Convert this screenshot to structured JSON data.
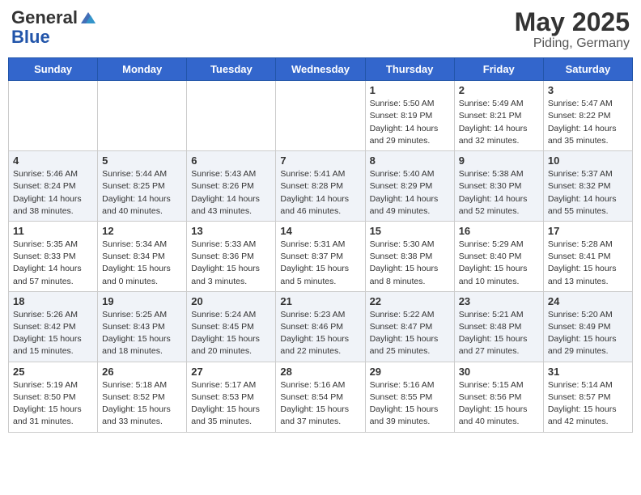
{
  "header": {
    "logo_general": "General",
    "logo_blue": "Blue",
    "month": "May 2025",
    "location": "Piding, Germany"
  },
  "weekdays": [
    "Sunday",
    "Monday",
    "Tuesday",
    "Wednesday",
    "Thursday",
    "Friday",
    "Saturday"
  ],
  "weeks": [
    [
      {
        "day": "",
        "info": ""
      },
      {
        "day": "",
        "info": ""
      },
      {
        "day": "",
        "info": ""
      },
      {
        "day": "",
        "info": ""
      },
      {
        "day": "1",
        "info": "Sunrise: 5:50 AM\nSunset: 8:19 PM\nDaylight: 14 hours\nand 29 minutes."
      },
      {
        "day": "2",
        "info": "Sunrise: 5:49 AM\nSunset: 8:21 PM\nDaylight: 14 hours\nand 32 minutes."
      },
      {
        "day": "3",
        "info": "Sunrise: 5:47 AM\nSunset: 8:22 PM\nDaylight: 14 hours\nand 35 minutes."
      }
    ],
    [
      {
        "day": "4",
        "info": "Sunrise: 5:46 AM\nSunset: 8:24 PM\nDaylight: 14 hours\nand 38 minutes."
      },
      {
        "day": "5",
        "info": "Sunrise: 5:44 AM\nSunset: 8:25 PM\nDaylight: 14 hours\nand 40 minutes."
      },
      {
        "day": "6",
        "info": "Sunrise: 5:43 AM\nSunset: 8:26 PM\nDaylight: 14 hours\nand 43 minutes."
      },
      {
        "day": "7",
        "info": "Sunrise: 5:41 AM\nSunset: 8:28 PM\nDaylight: 14 hours\nand 46 minutes."
      },
      {
        "day": "8",
        "info": "Sunrise: 5:40 AM\nSunset: 8:29 PM\nDaylight: 14 hours\nand 49 minutes."
      },
      {
        "day": "9",
        "info": "Sunrise: 5:38 AM\nSunset: 8:30 PM\nDaylight: 14 hours\nand 52 minutes."
      },
      {
        "day": "10",
        "info": "Sunrise: 5:37 AM\nSunset: 8:32 PM\nDaylight: 14 hours\nand 55 minutes."
      }
    ],
    [
      {
        "day": "11",
        "info": "Sunrise: 5:35 AM\nSunset: 8:33 PM\nDaylight: 14 hours\nand 57 minutes."
      },
      {
        "day": "12",
        "info": "Sunrise: 5:34 AM\nSunset: 8:34 PM\nDaylight: 15 hours\nand 0 minutes."
      },
      {
        "day": "13",
        "info": "Sunrise: 5:33 AM\nSunset: 8:36 PM\nDaylight: 15 hours\nand 3 minutes."
      },
      {
        "day": "14",
        "info": "Sunrise: 5:31 AM\nSunset: 8:37 PM\nDaylight: 15 hours\nand 5 minutes."
      },
      {
        "day": "15",
        "info": "Sunrise: 5:30 AM\nSunset: 8:38 PM\nDaylight: 15 hours\nand 8 minutes."
      },
      {
        "day": "16",
        "info": "Sunrise: 5:29 AM\nSunset: 8:40 PM\nDaylight: 15 hours\nand 10 minutes."
      },
      {
        "day": "17",
        "info": "Sunrise: 5:28 AM\nSunset: 8:41 PM\nDaylight: 15 hours\nand 13 minutes."
      }
    ],
    [
      {
        "day": "18",
        "info": "Sunrise: 5:26 AM\nSunset: 8:42 PM\nDaylight: 15 hours\nand 15 minutes."
      },
      {
        "day": "19",
        "info": "Sunrise: 5:25 AM\nSunset: 8:43 PM\nDaylight: 15 hours\nand 18 minutes."
      },
      {
        "day": "20",
        "info": "Sunrise: 5:24 AM\nSunset: 8:45 PM\nDaylight: 15 hours\nand 20 minutes."
      },
      {
        "day": "21",
        "info": "Sunrise: 5:23 AM\nSunset: 8:46 PM\nDaylight: 15 hours\nand 22 minutes."
      },
      {
        "day": "22",
        "info": "Sunrise: 5:22 AM\nSunset: 8:47 PM\nDaylight: 15 hours\nand 25 minutes."
      },
      {
        "day": "23",
        "info": "Sunrise: 5:21 AM\nSunset: 8:48 PM\nDaylight: 15 hours\nand 27 minutes."
      },
      {
        "day": "24",
        "info": "Sunrise: 5:20 AM\nSunset: 8:49 PM\nDaylight: 15 hours\nand 29 minutes."
      }
    ],
    [
      {
        "day": "25",
        "info": "Sunrise: 5:19 AM\nSunset: 8:50 PM\nDaylight: 15 hours\nand 31 minutes."
      },
      {
        "day": "26",
        "info": "Sunrise: 5:18 AM\nSunset: 8:52 PM\nDaylight: 15 hours\nand 33 minutes."
      },
      {
        "day": "27",
        "info": "Sunrise: 5:17 AM\nSunset: 8:53 PM\nDaylight: 15 hours\nand 35 minutes."
      },
      {
        "day": "28",
        "info": "Sunrise: 5:16 AM\nSunset: 8:54 PM\nDaylight: 15 hours\nand 37 minutes."
      },
      {
        "day": "29",
        "info": "Sunrise: 5:16 AM\nSunset: 8:55 PM\nDaylight: 15 hours\nand 39 minutes."
      },
      {
        "day": "30",
        "info": "Sunrise: 5:15 AM\nSunset: 8:56 PM\nDaylight: 15 hours\nand 40 minutes."
      },
      {
        "day": "31",
        "info": "Sunrise: 5:14 AM\nSunset: 8:57 PM\nDaylight: 15 hours\nand 42 minutes."
      }
    ]
  ]
}
